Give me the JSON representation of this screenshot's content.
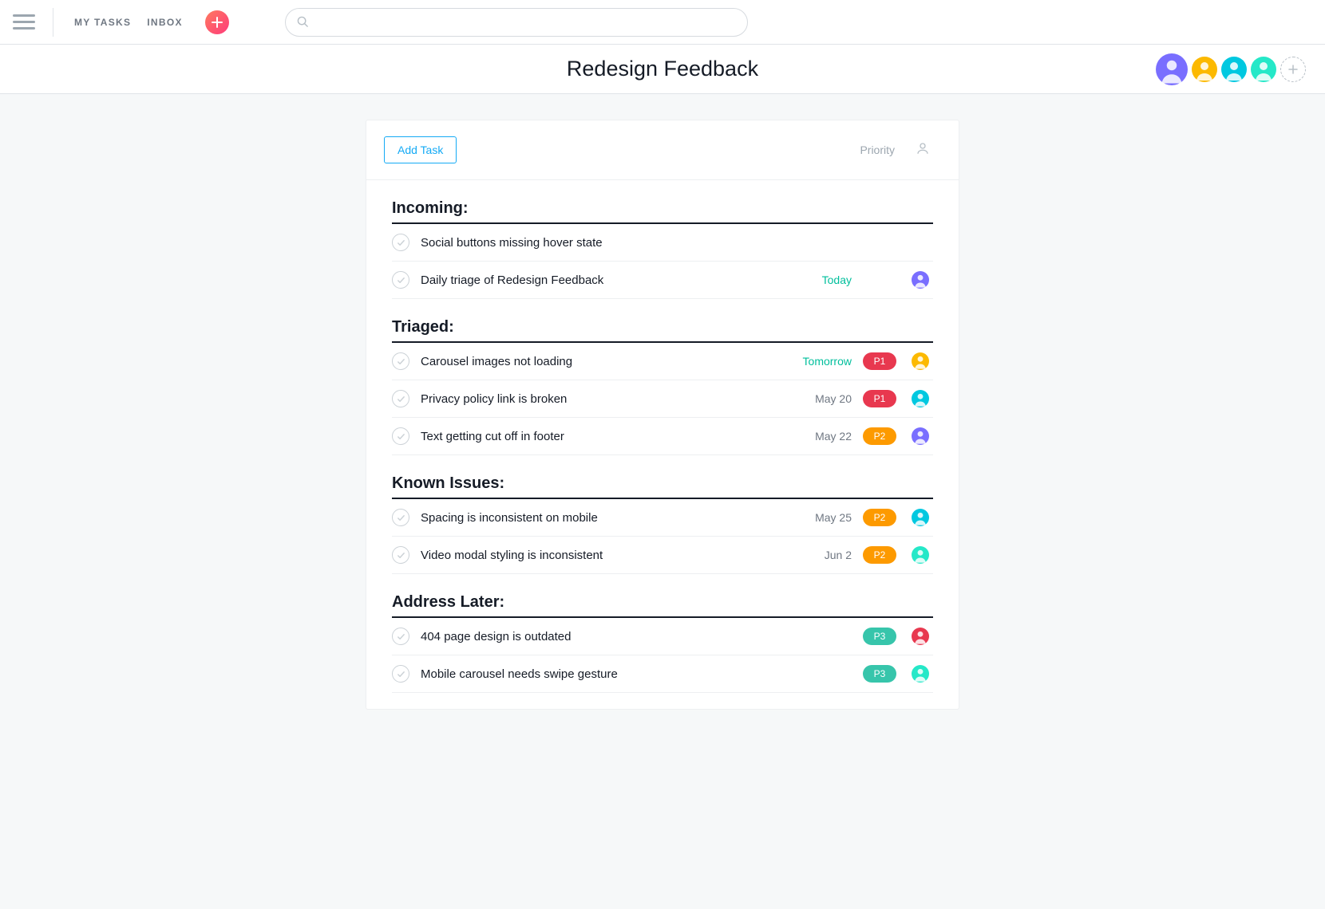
{
  "nav": {
    "my_tasks": "MY TASKS",
    "inbox": "INBOX"
  },
  "search": {
    "placeholder": ""
  },
  "page_title": "Redesign Feedback",
  "panel": {
    "add_task": "Add Task",
    "priority_label": "Priority"
  },
  "members": [
    {
      "color": "#796eff"
    },
    {
      "color": "#fcb900"
    },
    {
      "color": "#00c8e0"
    },
    {
      "color": "#25e8c8"
    }
  ],
  "priority_colors": {
    "P1": "#e8384f",
    "P2": "#fd9a00",
    "P3": "#37c5ab"
  },
  "sections": [
    {
      "title": "Incoming:",
      "tasks": [
        {
          "title": "Social buttons missing hover state",
          "date": "",
          "date_green": false,
          "priority": "",
          "assignee": ""
        },
        {
          "title": "Daily triage of Redesign Feedback",
          "date": "Today",
          "date_green": true,
          "priority": "",
          "assignee": "#796eff"
        }
      ]
    },
    {
      "title": "Triaged:",
      "tasks": [
        {
          "title": "Carousel images not loading",
          "date": "Tomorrow",
          "date_green": true,
          "priority": "P1",
          "assignee": "#fcb900"
        },
        {
          "title": "Privacy policy link is broken",
          "date": "May 20",
          "date_green": false,
          "priority": "P1",
          "assignee": "#00c8e0"
        },
        {
          "title": "Text getting cut off in footer",
          "date": "May 22",
          "date_green": false,
          "priority": "P2",
          "assignee": "#796eff"
        }
      ]
    },
    {
      "title": "Known Issues:",
      "tasks": [
        {
          "title": "Spacing is inconsistent on mobile",
          "date": "May 25",
          "date_green": false,
          "priority": "P2",
          "assignee": "#00c8e0"
        },
        {
          "title": "Video modal styling is inconsistent",
          "date": "Jun 2",
          "date_green": false,
          "priority": "P2",
          "assignee": "#25e8c8"
        }
      ]
    },
    {
      "title": "Address Later:",
      "tasks": [
        {
          "title": "404 page design is outdated",
          "date": "",
          "date_green": false,
          "priority": "P3",
          "assignee": "#e8384f"
        },
        {
          "title": "Mobile carousel needs swipe gesture",
          "date": "",
          "date_green": false,
          "priority": "P3",
          "assignee": "#25e8c8"
        }
      ]
    }
  ]
}
